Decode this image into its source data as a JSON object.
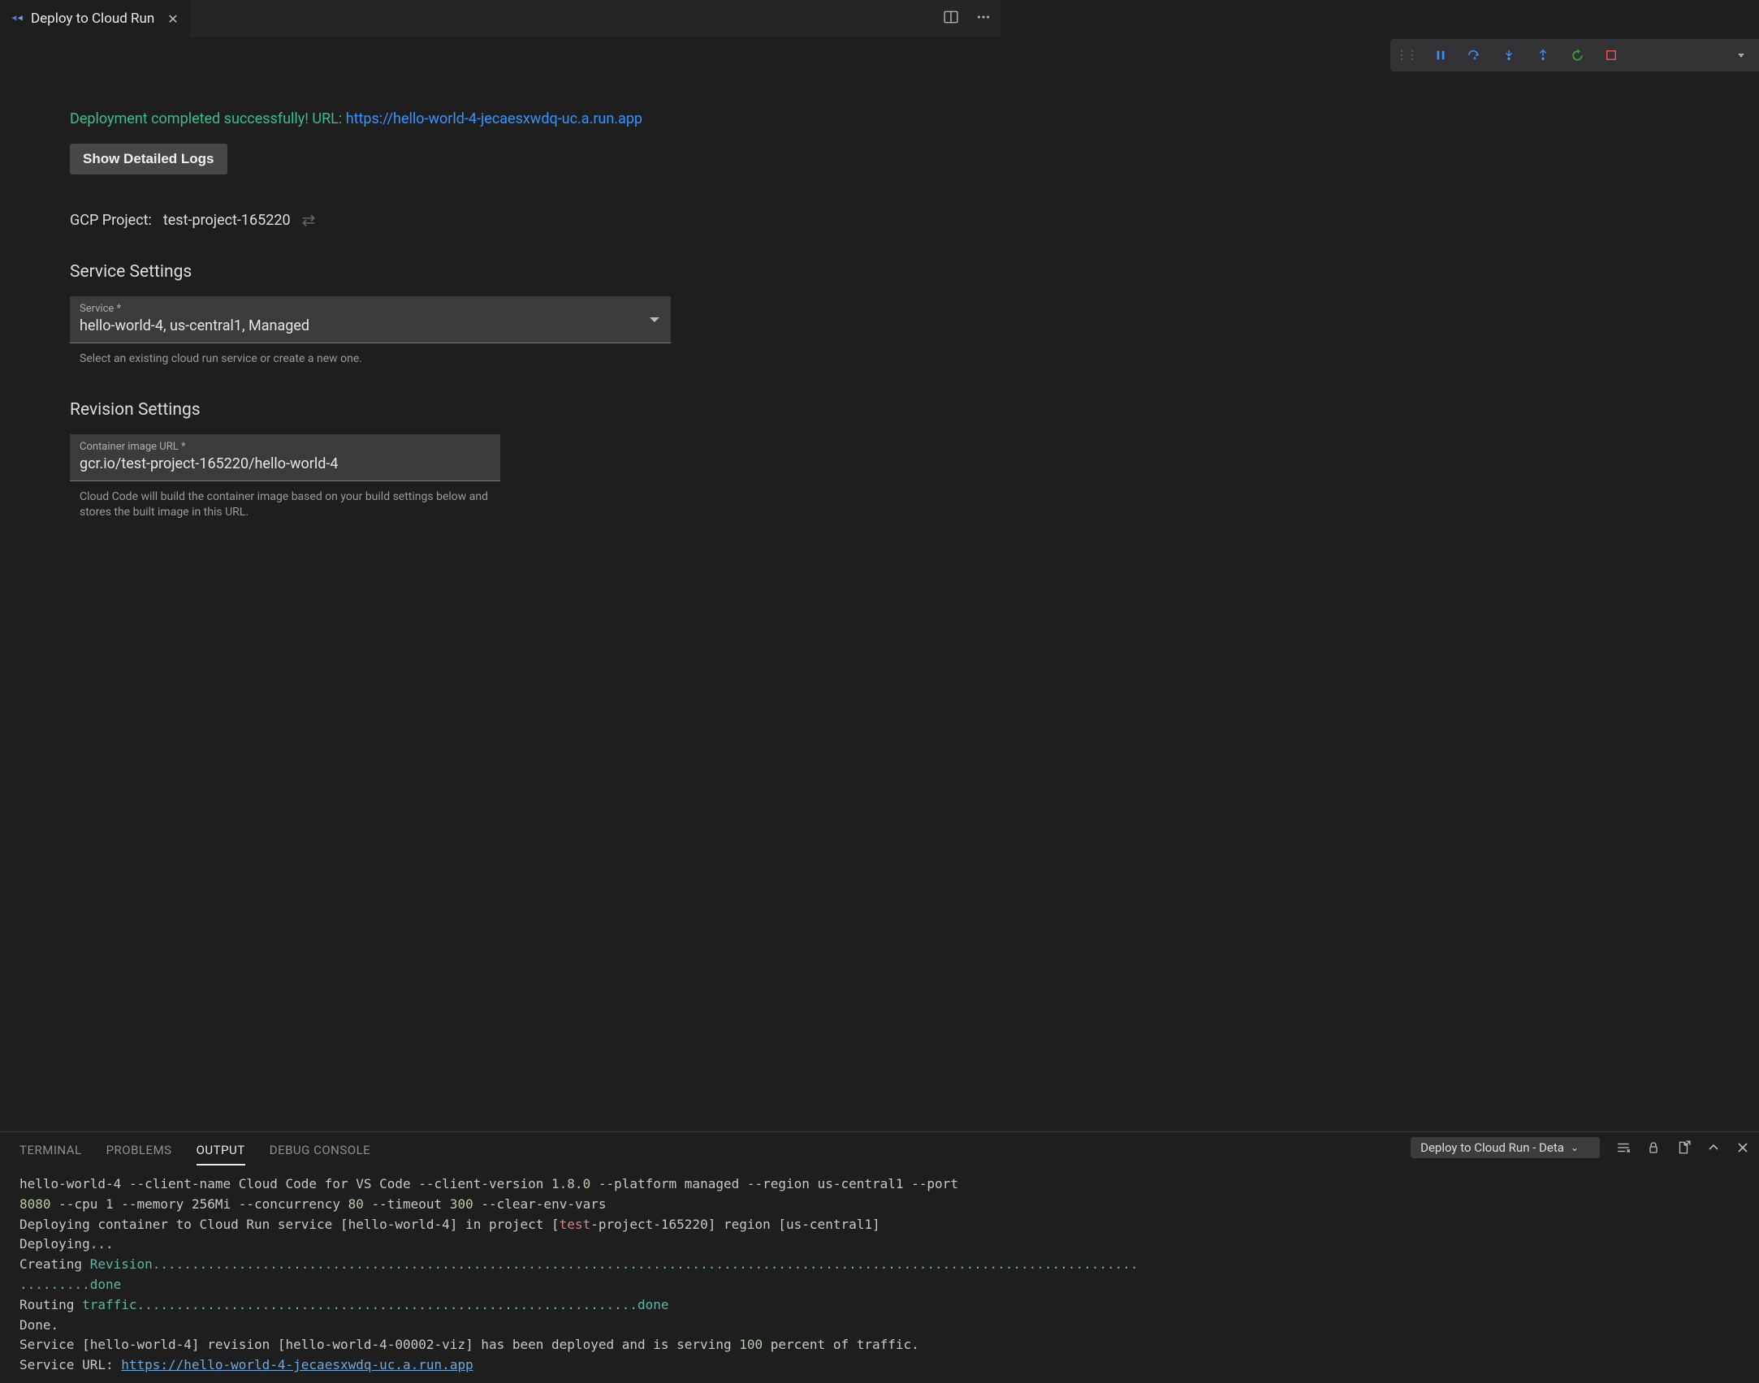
{
  "tab": {
    "title": "Deploy to Cloud Run"
  },
  "status": {
    "message": "Deployment completed successfully! URL: ",
    "url": "https://hello-world-4-jecaesxwdq-uc.a.run.app"
  },
  "buttons": {
    "show_logs": "Show Detailed Logs"
  },
  "gcp": {
    "label": "GCP Project:",
    "value": "test-project-165220"
  },
  "sections": {
    "service": "Service Settings",
    "revision": "Revision Settings"
  },
  "service_field": {
    "label": "Service *",
    "value": "hello-world-4, us-central1, Managed",
    "hint": "Select an existing cloud run service or create a new one."
  },
  "container_field": {
    "label": "Container image URL *",
    "value": "gcr.io/test-project-165220/hello-world-4",
    "hint": "Cloud Code will build the container image based on your build settings below and stores the built image in this URL."
  },
  "panel": {
    "tabs": {
      "terminal": "TERMINAL",
      "problems": "PROBLEMS",
      "output": "OUTPUT",
      "debug": "DEBUG CONSOLE"
    },
    "selector": "Deploy to Cloud Run - Deta"
  },
  "output": {
    "line1_a": "hello-world-4 --client-name Cloud Code for VS Code --client-version ",
    "v1": "1.8.0",
    "line1_b": " --platform managed --region us-central1 --port",
    "v2": "8080",
    "line2_a": " --cpu ",
    "v3": "1",
    "line2_b": " --memory 256Mi --concurrency ",
    "v4": "80",
    "line2_c": " --timeout ",
    "v5": "300",
    "line2_d": " --clear-env-vars",
    "line3_a": "Deploying container to Cloud Run service [hello-world-4] in project [",
    "test_red": "test",
    "line3_b": "-project-165220] region [us-central1]",
    "line4": "Deploying...",
    "line5_a": "Creating ",
    "line5_b": "Revision",
    "dots1": "..............................................................................................................................",
    "dots2": ".........",
    "done1": "done",
    "line7_a": "Routing ",
    "line7_b": "traffic",
    "dots3": "................................................................",
    "done2": "done",
    "line8": "Done.",
    "line9_a": "Service [hello-world-4] revision [hello-world-4-00002-viz] has been deployed and is serving ",
    "v100": "100",
    "line9_b": " percent of traffic.",
    "line10_a": "Service URL: ",
    "line10_url": "https://hello-world-4-jecaesxwdq-uc.a.run.app"
  }
}
